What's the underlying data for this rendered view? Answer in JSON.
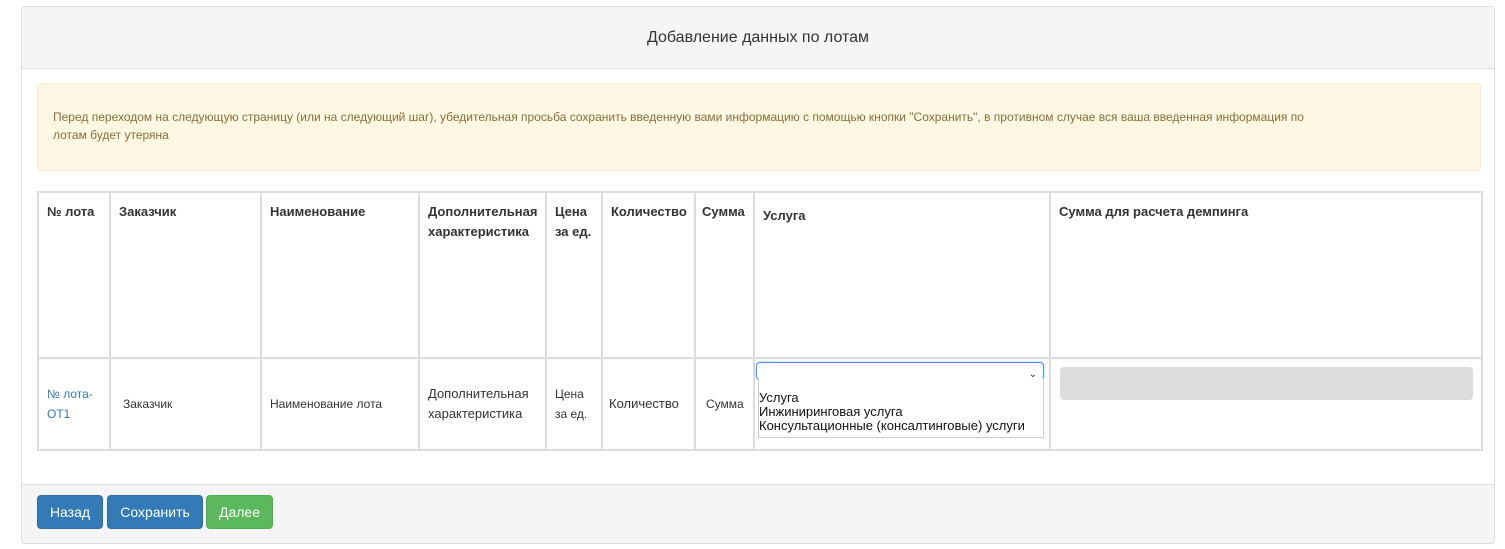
{
  "panel": {
    "title": "Добавление данных по лотам"
  },
  "alert": {
    "text": "Перед переходом на следующую страницу (или на следующий шаг), убедительная просьба сохранить введенную вами информацию с помощью кнопки \"Сохранить\", в противном случае вся ваша введенная информация по лотам будет утеряна"
  },
  "table": {
    "headers": {
      "lot_no": "№ лота",
      "customer": "Заказчик",
      "name": "Наименование",
      "extra": "Дополнительная характеристика",
      "price": "Цена за ед.",
      "qty": "Количество",
      "sum": "Сумма",
      "service": "Услуга",
      "dumping": "Сумма для расчета демпинга"
    },
    "row": {
      "lot_no": "№ лота-ОТ1",
      "customer": "Заказчик",
      "name": "Наименование лота",
      "extra": "Дополнительная характеристика",
      "price": "Цена за ед.",
      "qty": "Количество",
      "sum": "Сумма",
      "service_value": "",
      "service_options": [
        "Услуга",
        "Инжиниринговая услуга",
        "Консультационные (консалтинговые) услуги"
      ],
      "dumping_value": ""
    }
  },
  "footer": {
    "back_label": "Назад",
    "save_label": "Сохранить",
    "next_label": "Далее"
  },
  "colors": {
    "primary": "#337ab7",
    "success": "#5cb85c",
    "alert_bg": "#fcf8e3",
    "alert_text": "#8a6d3b"
  }
}
